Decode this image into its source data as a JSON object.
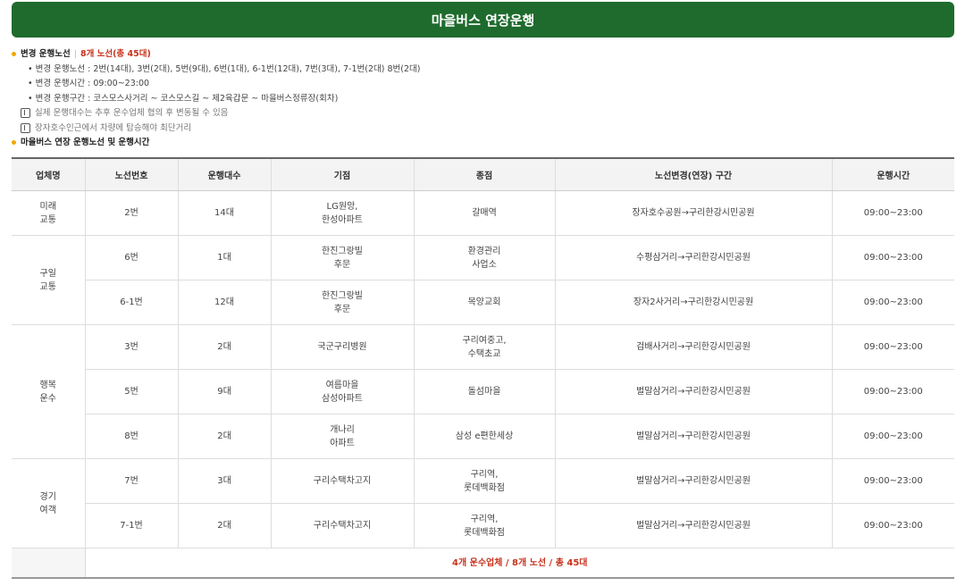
{
  "banner": {
    "title": "마을버스 연장운행"
  },
  "info": {
    "changed_routes_label": "변경 운행노선",
    "changed_routes_highlight": "8개 노선(총 45대)",
    "routes_detail": "• 변경 운행노선 : 2번(14대), 3번(2대), 5번(9대), 6번(1대), 6-1번(12대), 7번(3대), 7-1번(2대) 8번(2대)",
    "hours_detail": "• 변경 운행시간 : 09:00~23:00",
    "section_detail": "• 변경 운행구간 : 코스모스사거리 ~ 코스모스길 ~ 제2육갑문 ~ 마을버스정류장(회차)",
    "note1": "실제 운행대수는 추후 운수업체 협의 후 변동될 수 있음",
    "note2": "장자호수인근에서 차량에 탑승해야 최단거리",
    "table_title": "마을버스 연장 운행노선 및 운행시간"
  },
  "table": {
    "headers": [
      "업체명",
      "노선번호",
      "운행대수",
      "기점",
      "종점",
      "노선변경(연장) 구간",
      "운행시간"
    ],
    "groups": [
      {
        "company": "미래\n교통",
        "rows": [
          {
            "route": "2번",
            "buses": "14대",
            "start": "LG원앙,\n한성아파트",
            "end": "갈매역",
            "section": "장자호수공원→구리한강시민공원",
            "hours": "09:00~23:00"
          }
        ]
      },
      {
        "company": "구일\n교통",
        "rows": [
          {
            "route": "6번",
            "buses": "1대",
            "start": "한진그랑빌\n후문",
            "end": "환경관리\n사업소",
            "section": "수평삼거리→구리한강시민공원",
            "hours": "09:00~23:00"
          },
          {
            "route": "6-1번",
            "buses": "12대",
            "start": "한진그랑빌\n후문",
            "end": "목양교회",
            "section": "장자2사거리→구리한강시민공원",
            "hours": "09:00~23:00"
          }
        ]
      },
      {
        "company": "행복\n운수",
        "rows": [
          {
            "route": "3번",
            "buses": "2대",
            "start": "국군구리병원",
            "end": "구리여중고,\n수택초교",
            "section": "검배사거리→구리한강시민공원",
            "hours": "09:00~23:00"
          },
          {
            "route": "5번",
            "buses": "9대",
            "start": "여름마을\n삼성아파트",
            "end": "돌섬마을",
            "section": "벌말삼거리→구리한강시민공원",
            "hours": "09:00~23:00"
          },
          {
            "route": "8번",
            "buses": "2대",
            "start": "개나리\n아파트",
            "end": "삼성 e편한세상",
            "section": "벌말삼거리→구리한강시민공원",
            "hours": "09:00~23:00"
          }
        ]
      },
      {
        "company": "경기\n여객",
        "rows": [
          {
            "route": "7번",
            "buses": "3대",
            "start": "구리수택차고지",
            "end": "구리역,\n롯데백화점",
            "section": "벌말삼거리→구리한강시민공원",
            "hours": "09:00~23:00"
          },
          {
            "route": "7-1번",
            "buses": "2대",
            "start": "구리수택차고지",
            "end": "구리역,\n롯데백화점",
            "section": "벌말삼거리→구리한강시민공원",
            "hours": "09:00~23:00"
          }
        ]
      }
    ],
    "total": "4개 운수업체 / 8개 노선 / 총 45대"
  }
}
